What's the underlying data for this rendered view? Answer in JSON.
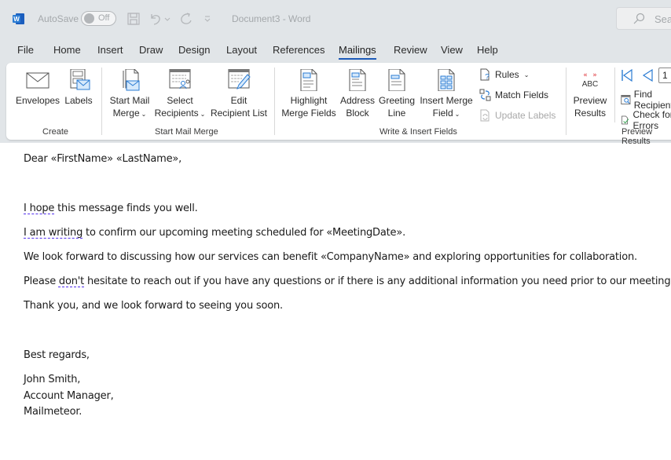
{
  "titlebar": {
    "autosave_label": "AutoSave",
    "autosave_state": "Off",
    "document_title": "Document3  -  Word",
    "search_placeholder": "Search"
  },
  "tabs": [
    {
      "label": "File"
    },
    {
      "label": "Home"
    },
    {
      "label": "Insert"
    },
    {
      "label": "Draw"
    },
    {
      "label": "Design"
    },
    {
      "label": "Layout"
    },
    {
      "label": "References"
    },
    {
      "label": "Mailings",
      "active": true
    },
    {
      "label": "Review"
    },
    {
      "label": "View"
    },
    {
      "label": "Help"
    }
  ],
  "ribbon": {
    "create": {
      "label": "Create",
      "envelopes": "Envelopes",
      "labels": "Labels"
    },
    "start_mail_merge": {
      "label": "Start Mail Merge",
      "start_line1": "Start Mail",
      "start_line2": "Merge",
      "select_line1": "Select",
      "select_line2": "Recipients",
      "edit_line1": "Edit",
      "edit_line2": "Recipient List"
    },
    "write_insert": {
      "label": "Write & Insert Fields",
      "highlight_line1": "Highlight",
      "highlight_line2": "Merge Fields",
      "address_line1": "Address",
      "address_line2": "Block",
      "greeting_line1": "Greeting",
      "greeting_line2": "Line",
      "insert_line1": "Insert Merge",
      "insert_line2": "Field",
      "rules": "Rules",
      "match_fields": "Match Fields",
      "update_labels": "Update Labels"
    },
    "preview": {
      "label": "Preview Results",
      "abc_text": "ABC",
      "preview_line1": "Preview",
      "preview_line2": "Results",
      "record_number": "1",
      "find_recipient": "Find Recipient",
      "check_errors": "Check for Errors"
    }
  },
  "document": {
    "greeting": "Dear «FirstName» «LastName»,",
    "line1_sq": "I hope",
    "line1_rest": " this message finds you well.",
    "line2_sq": "I am writing",
    "line2_rest": " to confirm our upcoming meeting scheduled for «MeetingDate».",
    "line3": "We look forward to discussing how our services can benefit «CompanyName» and exploring opportunities for collaboration.",
    "line4_pre": "Please ",
    "line4_sq": "don't",
    "line4_rest": " hesitate to reach out if you have any questions or if there is any additional information you need prior to our meeting.",
    "line5": "Thank you, and we look forward to seeing you soon.",
    "closing": "Best regards,",
    "sig_name": "John Smith,",
    "sig_title": "Account Manager,",
    "sig_company": "Mailmeteor."
  },
  "colors": {
    "accent": "#1c5ab8",
    "chrome_bg": "#e1e5e8",
    "icon_blue": "#2b7cd3",
    "squiggle": "#6a4cf0",
    "preview_red": "#e0383e"
  }
}
